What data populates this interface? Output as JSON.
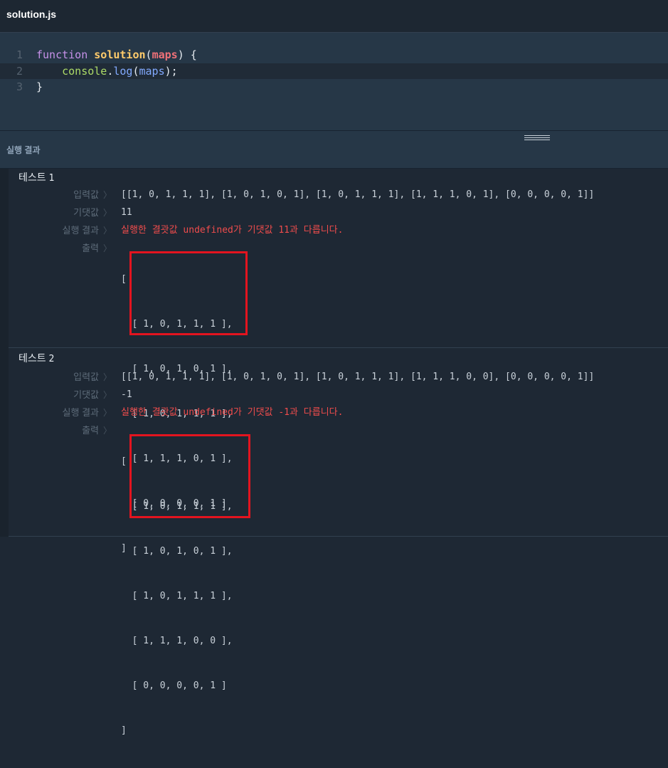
{
  "file": {
    "name": "solution.js"
  },
  "code": {
    "line_numbers": [
      "1",
      "2",
      "3"
    ],
    "line1": {
      "kw": "function",
      "fn": "solution",
      "open": "(",
      "param": "maps",
      "close": ") {"
    },
    "line2": {
      "indent": "    ",
      "obj": "console",
      "dot": ".",
      "method": "log",
      "open": "(",
      "arg": "maps",
      "close": ");"
    },
    "line3": {
      "text": "}"
    }
  },
  "results_panel": {
    "title": "실행 결과"
  },
  "labels": {
    "input": "입력값",
    "expected": "기댓값",
    "result": "실행 결과",
    "output": "출력",
    "chevron": "〉"
  },
  "tests": [
    {
      "title": "테스트",
      "number": "1",
      "input": "[[1, 0, 1, 1, 1], [1, 0, 1, 0, 1], [1, 0, 1, 1, 1], [1, 1, 1, 0, 1], [0, 0, 0, 0, 1]]",
      "expected": "11",
      "result": "실행한 결괏값 undefined가 기댓값 11과 다릅니다.",
      "output": [
        "[",
        "  [ 1, 0, 1, 1, 1 ],",
        "  [ 1, 0, 1, 0, 1 ],",
        "  [ 1, 0, 1, 1, 1 ],",
        "  [ 1, 1, 1, 0, 1 ],",
        "  [ 0, 0, 0, 0, 1 ]",
        "]"
      ]
    },
    {
      "title": "테스트",
      "number": "2",
      "input": "[[1, 0, 1, 1, 1], [1, 0, 1, 0, 1], [1, 0, 1, 1, 1], [1, 1, 1, 0, 0], [0, 0, 0, 0, 1]]",
      "expected": "-1",
      "result": "실행한 결괏값 undefined가 기댓값 -1과 다릅니다.",
      "output": [
        "[",
        "  [ 1, 0, 1, 1, 1 ],",
        "  [ 1, 0, 1, 0, 1 ],",
        "  [ 1, 0, 1, 1, 1 ],",
        "  [ 1, 1, 1, 0, 0 ],",
        "  [ 0, 0, 0, 0, 1 ]",
        "]"
      ]
    }
  ],
  "colors": {
    "highlight_box": "#e3141f",
    "error_text": "#f04c4c",
    "editor_bg": "#263747"
  }
}
